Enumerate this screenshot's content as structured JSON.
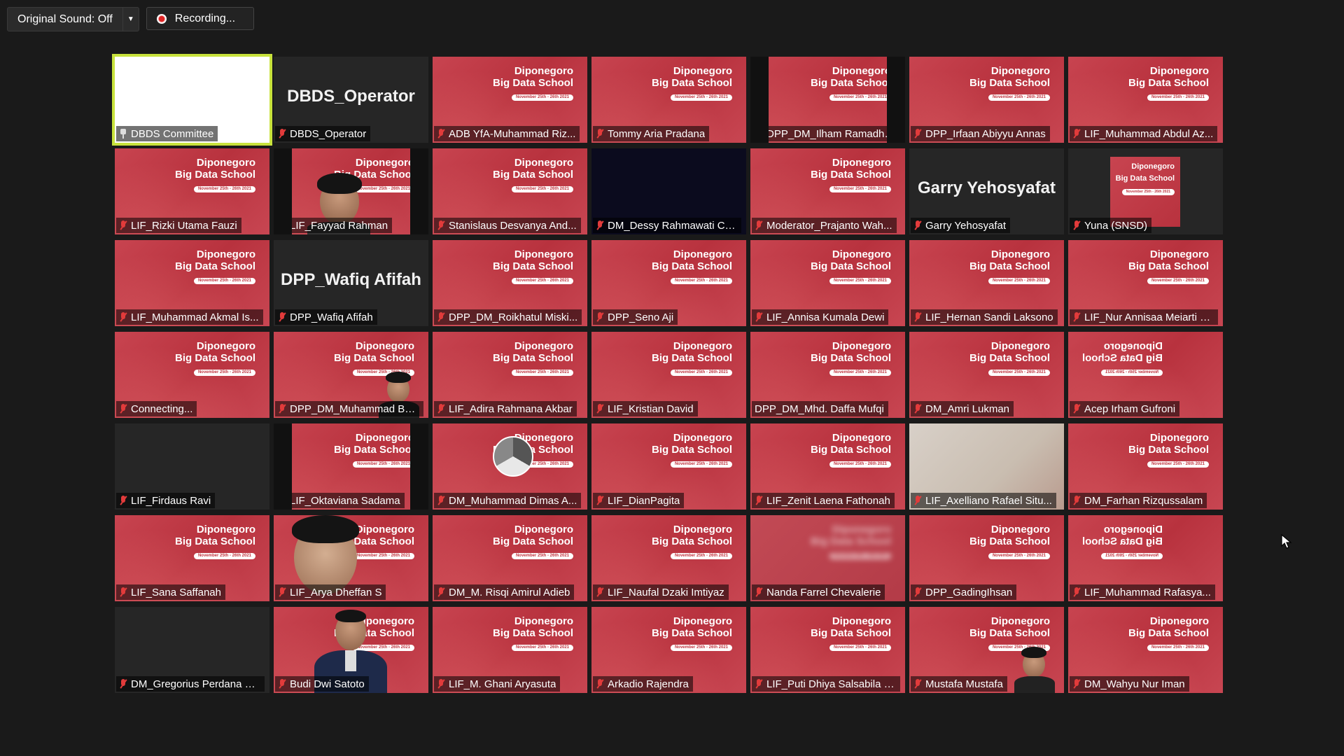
{
  "toolbar": {
    "original_sound_label": "Original Sound: Off",
    "recording_label": "Recording..."
  },
  "colors": {
    "background": "#1a1a1a",
    "active_speaker_border": "#c8e23c",
    "banner_red": "#c0343f",
    "muted_icon": "#e23b3b"
  },
  "brand": {
    "line1": "Diponegoro",
    "line2": "Big Data School",
    "date": "November 25th - 26th 2021"
  },
  "participants": [
    {
      "name": "DBDS Committee",
      "style": "active",
      "icon": "pin-icon"
    },
    {
      "name": "DBDS_Operator",
      "style": "text",
      "bigtext": "DBDS_Operator",
      "icon": "mic-muted-icon"
    },
    {
      "name": "ADB YfA-Muhammad Riz...",
      "style": "banner",
      "icon": "mic-muted-icon"
    },
    {
      "name": "Tommy Aria Pradana",
      "style": "banner",
      "icon": "mic-muted-icon"
    },
    {
      "name": "DPP_DM_Ilham Ramadha...",
      "style": "banner-pillar",
      "icon": "mic-muted-icon"
    },
    {
      "name": "DPP_Irfaan Abiyyu Annas",
      "style": "banner",
      "icon": "mic-muted-icon"
    },
    {
      "name": "LIF_Muhammad Abdul Az...",
      "style": "banner",
      "icon": "mic-muted-icon"
    },
    {
      "name": "LIF_Rizki Utama Fauzi",
      "style": "banner",
      "icon": "mic-muted-icon"
    },
    {
      "name": "LIF_Fayyad Rahman",
      "style": "banner-person-pillar",
      "icon": "mic-muted-icon"
    },
    {
      "name": "Stanislaus Desvanya And...",
      "style": "banner",
      "icon": "mic-muted-icon"
    },
    {
      "name": "DM_Dessy Rahmawati Ch...",
      "style": "dark",
      "icon": "mic-muted-icon"
    },
    {
      "name": "Moderator_Prajanto Wah...",
      "style": "banner",
      "icon": "mic-muted-icon"
    },
    {
      "name": "Garry Yehosyafat",
      "style": "text",
      "bigtext": "Garry Yehosyafat",
      "icon": "mic-muted-icon"
    },
    {
      "name": "Yuna (SNSD)",
      "style": "small-thumb",
      "icon": "mic-muted-icon"
    },
    {
      "name": "LIF_Muhammad Akmal Is...",
      "style": "banner",
      "icon": "mic-muted-icon"
    },
    {
      "name": "DPP_Wafiq Afifah",
      "style": "text",
      "bigtext": "DPP_Wafiq Afifah",
      "icon": "mic-muted-icon"
    },
    {
      "name": "DPP_DM_Roikhatul Miski...",
      "style": "banner",
      "icon": "mic-muted-icon"
    },
    {
      "name": "DPP_Seno Aji",
      "style": "banner",
      "icon": "mic-muted-icon"
    },
    {
      "name": "LIF_Annisa Kumala Dewi",
      "style": "banner",
      "icon": "mic-muted-icon"
    },
    {
      "name": "LIF_Hernan Sandi Laksono",
      "style": "banner",
      "icon": "mic-muted-icon"
    },
    {
      "name": "LIF_Nur Annisaa Meiarti F...",
      "style": "banner",
      "icon": "mic-muted-icon"
    },
    {
      "name": "Connecting...",
      "style": "banner",
      "icon": "mic-muted-icon"
    },
    {
      "name": "DPP_DM_Muhammad Ba...",
      "style": "banner-person-small",
      "icon": "mic-muted-icon"
    },
    {
      "name": "LIF_Adira Rahmana Akbar",
      "style": "banner",
      "icon": "mic-muted-icon"
    },
    {
      "name": "LIF_Kristian David",
      "style": "banner",
      "icon": "mic-muted-icon"
    },
    {
      "name": "DPP_DM_Mhd. Daffa Mufqi",
      "style": "banner",
      "icon": "none"
    },
    {
      "name": "DM_Amri Lukman",
      "style": "banner",
      "icon": "mic-muted-icon"
    },
    {
      "name": "Acep Irham Gufroni",
      "style": "banner-mirror",
      "icon": "mic-muted-icon"
    },
    {
      "name": "LIF_Firdaus Ravi",
      "style": "plain",
      "icon": "mic-muted-icon"
    },
    {
      "name": "LIF_Oktaviana Sadama",
      "style": "banner-pillar",
      "icon": "mic-muted-icon"
    },
    {
      "name": "DM_Muhammad Dimas A...",
      "style": "banner-logo",
      "icon": "mic-muted-icon"
    },
    {
      "name": "LIF_DianPagita",
      "style": "banner",
      "icon": "mic-muted-icon"
    },
    {
      "name": "LIF_Zenit Laena Fathonah",
      "style": "banner",
      "icon": "mic-muted-icon"
    },
    {
      "name": "LIF_Axelliano Rafael Situ...",
      "style": "room",
      "icon": "mic-muted-icon"
    },
    {
      "name": "DM_Farhan Rizqussalam",
      "style": "banner",
      "icon": "mic-muted-icon"
    },
    {
      "name": "LIF_Sana Saffanah",
      "style": "banner",
      "icon": "mic-muted-icon"
    },
    {
      "name": "LIF_Arya Dheffan S",
      "style": "banner-person-large",
      "icon": "mic-muted-icon"
    },
    {
      "name": "DM_M. Risqi Amirul Adieb",
      "style": "banner",
      "icon": "mic-muted-icon"
    },
    {
      "name": "LIF_Naufal Dzaki Imtiyaz",
      "style": "banner",
      "icon": "mic-muted-icon"
    },
    {
      "name": "Nanda Farrel Chevalerie",
      "style": "blur",
      "icon": "mic-muted-icon"
    },
    {
      "name": "DPP_GadingIhsan",
      "style": "banner",
      "icon": "mic-muted-icon"
    },
    {
      "name": "LIF_Muhammad Rafasya...",
      "style": "banner-mirror",
      "icon": "mic-muted-icon"
    },
    {
      "name": "DM_Gregorius Perdana S...",
      "style": "plain",
      "icon": "mic-muted-icon"
    },
    {
      "name": "Budi Dwi Satoto",
      "style": "banner-person-suit",
      "icon": "mic-muted-icon"
    },
    {
      "name": "LIF_M. Ghani Aryasuta",
      "style": "banner",
      "icon": "mic-muted-icon"
    },
    {
      "name": "Arkadio Rajendra",
      "style": "banner",
      "icon": "mic-muted-icon"
    },
    {
      "name": "LIF_Puti Dhiya Salsabila R...",
      "style": "banner",
      "icon": "mic-muted-icon"
    },
    {
      "name": "Mustafa Mustafa",
      "style": "banner-person-small",
      "icon": "mic-muted-icon"
    },
    {
      "name": "DM_Wahyu Nur Iman",
      "style": "banner",
      "icon": "mic-muted-icon"
    }
  ]
}
